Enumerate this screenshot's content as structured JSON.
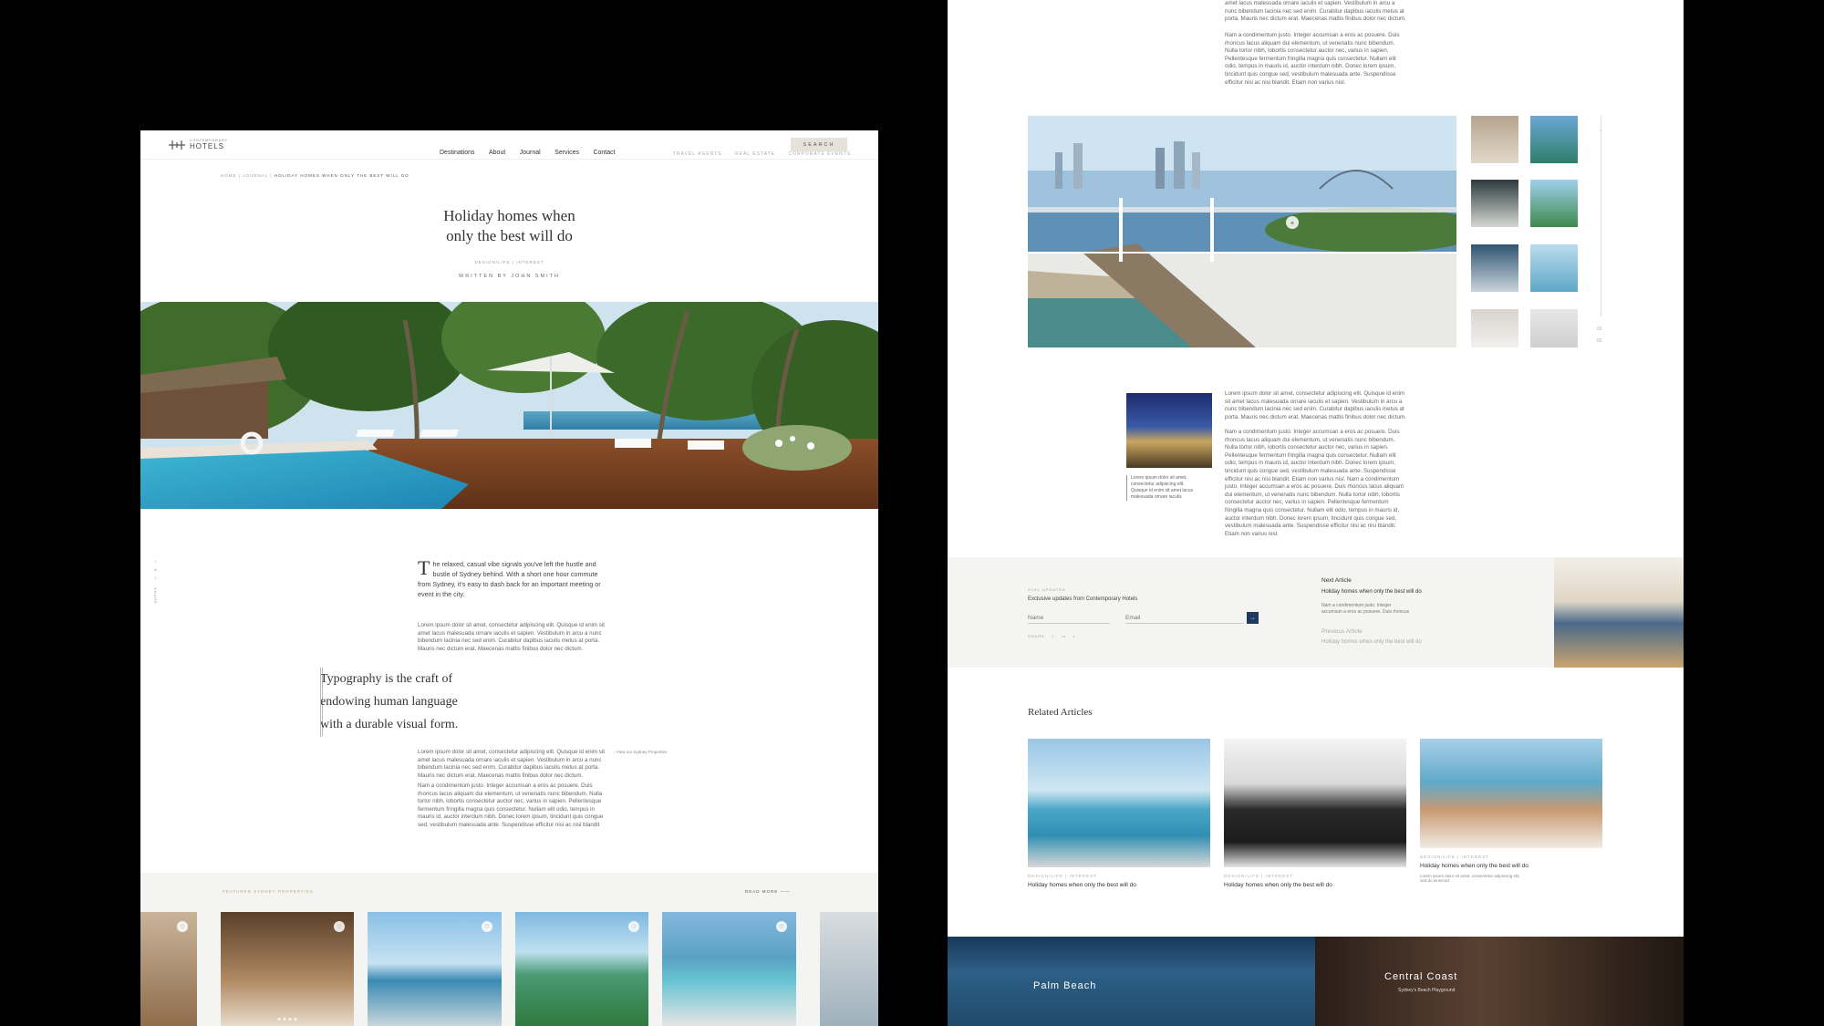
{
  "header": {
    "logo_top": "CONTEMPORARY",
    "logo_bottom": "HOTELS",
    "nav": [
      "Destinations",
      "About",
      "Journal",
      "Services",
      "Contact"
    ],
    "nav_right": [
      "TRAVEL AGENTS",
      "REAL ESTATE",
      "CORPORATE EVENTS"
    ],
    "search_label": "SEARCH"
  },
  "breadcrumb": {
    "home": "HOME",
    "sep": "|",
    "journal": "JOURNAL",
    "current": "HOLIDAY HOMES WHEN ONLY THE BEST WILL DO"
  },
  "article": {
    "title_line1": "Holiday homes when",
    "title_line2": "only the best will do",
    "category": "DESIGN/LIFE  |  INTEREST",
    "author": "WRITTEN BY JOHN SMITH",
    "share_label": "SHARE",
    "dropcap": "T",
    "intro": "he relaxed, casual vibe signals you've left the hustle and bustle of Sydney behind. With a short one hour commute from Sydney, it's easy to dash back for an important meeting or event in the city.",
    "body1": "Lorem ipsum dolor sit amet, consectetur adipiscing elit. Quisque id enim sit amet lacus malesuada ornare iaculis et sapien. Vestibulum in arcu a nunc bibendum lacinia nec sed enim. Curabitur dapibus iaculis metus at porta. Mauris nec dictum erat. Maecenas mattis finibus dolor nec dictum.",
    "quote_line1": "Typography is the craft of",
    "quote_line2": "endowing human language",
    "quote_line3": "with a durable visual form.",
    "aside_link": "View our Sydney Properties",
    "body2": "Lorem ipsum dolor sit amet, consectetur adipiscing elit. Quisque id enim sit amet lacus malesuada ornare iaculis et sapien. Vestibulum in arcu a nunc bibendum lacinia nec sed enim. Curabitur dapibus iaculis metus at porta. Mauris nec dictum erat. Maecenas mattis finibus dolor nec dictum.",
    "body3": "Nam a condimentum justo. Integer accumsan a eros ac posuere. Duis rhoncus lacus aliquam dui elementum, ut venenatis nunc bibendum. Nulla tortor nibh, lobortis consectetur auctor nec, varius in sapien. Pellentesque fermentum fringilla magna quis consectetur. Nullam elit odio, tempus in mauris id, auctor interdum nibh. Donec lorem ipsum, tincidunt quis congue sed, vestibulum malesuada ante. Suspendisse efficitur nisi ac nisi blandit"
  },
  "featured": {
    "label": "FEATURED SYDNEY PROPERTIES",
    "read_more": "READ MORE"
  },
  "right": {
    "top_body1": "amet lacus malesuada ornare iaculis et sapien. Vestibulum in arcu a nunc bibendum lacinia nec sed enim. Curabitur dapibus iaculis metus at porta. Mauris nec dictum erat. Maecenas mattis finibus dolor nec dictum.",
    "top_body2": "Nam a condimentum justo. Integer accumsan a eros ac posuere. Duis rhoncus lacus aliquam dui elementum, ut venenatis nunc bibendum. Nulla tortor nibh, lobortis consectetur auctor nec, varius in sapien. Pellentesque fermentum fringilla magna quis consectetur. Nullam elit odio, tempus in mauris id, auctor interdum nibh. Donec lorem ipsum, tincidunt quis congue sed, vestibulum malesuada ante. Suspendisse efficitur nisi ac nisi blandit. Etiam non varius nisl.",
    "gallery_counter_top": "01",
    "gallery_counter_bottom": "02",
    "caption": "Lorem ipsum dolor sit amet, consectetur adipiscing elit. Quisque id enim sit amet lacus malesuada ornare iaculis",
    "mid_body1": "Lorem ipsum dolor sit amet, consectetur adipiscing elit. Quisque id enim sit amet lacus malesuada ornare iaculis et sapien. Vestibulum in arcu a nunc bibendum lacinia nec sed enim. Curabitur dapibus iaculis metus at porta. Mauris nec dictum erat. Maecenas mattis finibus dolor nec dictum.",
    "mid_body2": "Nam a condimentum justo. Integer accumsan a eros ac posuere. Duis rhoncus lacus aliquam dui elementum, ut venenatis nunc bibendum. Nulla tortor nibh, lobortis consectetur auctor nec, varius in sapien. Pellentesque fermentum fringilla magna quis consectetur. Nullam elit odio, tempus in mauris id, auctor interdum nibh. Donec lorem ipsum, tincidunt quis congue sed, vestibulum malesuada ante. Suspendisse efficitur nisi ac nisi blandit. Etiam non varius nisl. Nam a condimentum justo. Integer accumsan a eros ac posuere. Duis rhoncus lacus aliquam dui elementum, ut venenatis nunc bibendum. Nulla tortor nibh, lobortis consectetur auctor nec, varius in sapien. Pellentesque fermentum fringilla magna quis consectetur. Nullam elit odio, tempus in mauris id, auctor interdum nibh. Donec lorem ipsum, tincidunt quis congue sed, vestibulum malesuada ante. Suspendisse efficitur nisi ac nisi blandit. Etiam non varius nisl.",
    "newsletter_label": "STAY UPDATED",
    "newsletter_text": "Exclusive updates from Contemporary Hotels",
    "name_placeholder": "Name",
    "email_placeholder": "Email",
    "submit_arrow": "→",
    "share_label": "SHARE",
    "next_label": "Next Article",
    "next_title": "Holiday homes when only the best will do",
    "next_excerpt": "Nam a condimentum justo. Integer accumsan a eros ac posuere. Duis rhoncus",
    "prev_label": "Previous Article",
    "prev_title": "Holiday homes when only the best will do",
    "related_heading": "Related Articles",
    "related": [
      {
        "meta": "DESIGN/LIFE  |  INTEREST",
        "title": "Holiday homes when only the best will do"
      },
      {
        "meta": "DESIGN/LIFE  |  INTEREST",
        "title": "Holiday homes when only the best will do"
      },
      {
        "meta": "DESIGN/LIFE  |  INTEREST",
        "title": "Holiday homes when only the best will do",
        "excerpt": "Lorem ipsum dolor sit amet, consectetur adipiscing elit, sed do eiusmod"
      }
    ],
    "dest_left": "Palm Beach",
    "dest_right": "Central Coast",
    "dest_right_sub": "Sydney's Beach Playground"
  },
  "colors": {
    "accent": "#1e3a5f",
    "beige": "#e6e2da",
    "panel_grey": "#f4f4f2"
  }
}
